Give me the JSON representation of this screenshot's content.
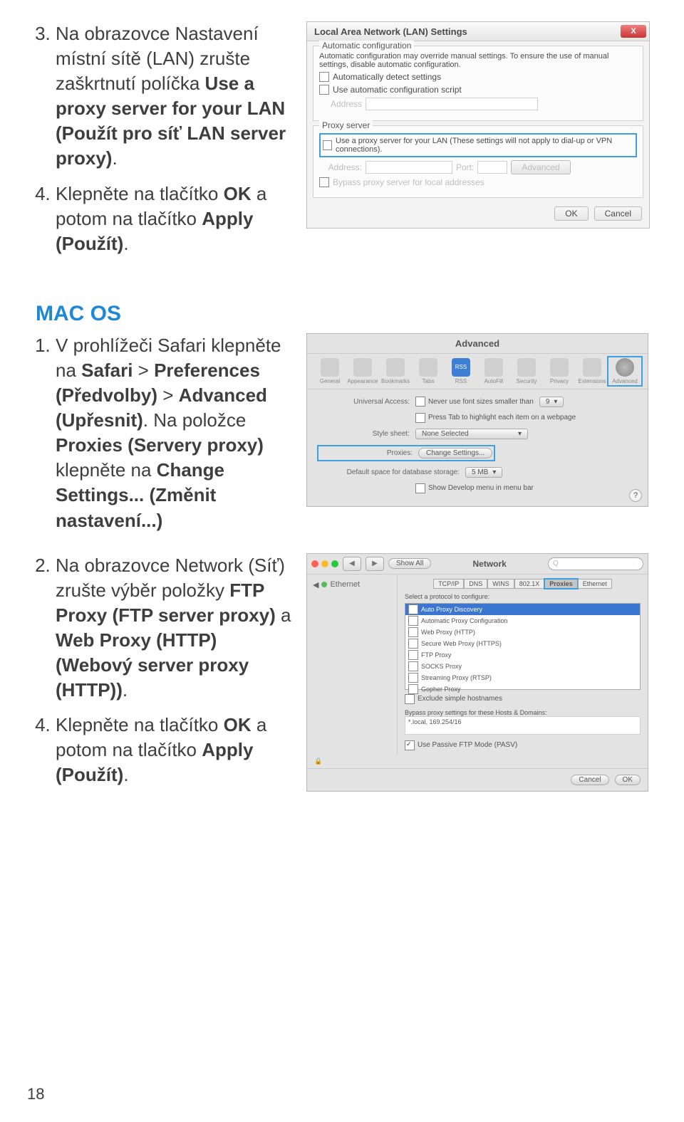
{
  "page_number": "18",
  "top_section": {
    "step3": {
      "num": "3.",
      "prefix": "Na obrazovce Nastavení místní sítě (LAN) zrušte zaškrtnutí políčka ",
      "bold1": "Use a proxy server for your LAN (Použít pro síť LAN server proxy)",
      "suffix": "."
    },
    "step4": {
      "num": "4.",
      "prefix": "Klepněte na tlačítko ",
      "bold1": "OK",
      "mid": " a potom na tlačítko ",
      "bold2": "Apply (Použít)",
      "suffix": "."
    }
  },
  "lan_dialog": {
    "title": "Local Area Network (LAN) Settings",
    "auto_caption": "Automatic configuration",
    "auto_desc": "Automatic configuration may override manual settings. To ensure the use of manual settings, disable automatic configuration.",
    "auto_detect": "Automatically detect settings",
    "auto_script": "Use automatic configuration script",
    "address_lbl": "Address",
    "proxy_caption": "Proxy server",
    "proxy_chk": "Use a proxy server for your LAN (These settings will not apply to dial-up or VPN connections).",
    "addr_lbl": "Address:",
    "port_lbl": "Port:",
    "advanced_btn": "Advanced",
    "bypass": "Bypass proxy server for local addresses",
    "ok": "OK",
    "cancel": "Cancel"
  },
  "macos_heading": "MAC OS",
  "macos_steps": {
    "step1": {
      "s1": "V prohlížeči Safari klepněte na ",
      "b1": "Safari",
      "s2": " > ",
      "b2": "Preferences (Předvolby)",
      "s3": " > ",
      "b3": "Advanced (Upřesnit)",
      "s4": ". Na položce ",
      "b4": "Proxies (Servery proxy)",
      "s5": " klepněte na ",
      "b5": "Change Settings... (Změnit nastavení...)"
    },
    "step2": {
      "s1": "Na obrazovce Network (Síť) zrušte výběr položky ",
      "b1": "FTP Proxy (FTP server proxy)",
      "s2": " a ",
      "b2": "Web Proxy (HTTP) (Webový server proxy (HTTP))",
      "s3": "."
    },
    "step4": {
      "s1": "Klepněte na tlačítko ",
      "b1": "OK",
      "s2": " a potom na tlačítko ",
      "b2": "Apply (Použít)",
      "s3": "."
    }
  },
  "mac_adv": {
    "title": "Advanced",
    "tabs": [
      "General",
      "Appearance",
      "Bookmarks",
      "Tabs",
      "RSS",
      "AutoFill",
      "Security",
      "Privacy",
      "Extensions",
      "Advanced"
    ],
    "ua_lbl": "Universal Access:",
    "ua_chk": "Never use font sizes smaller than",
    "ua_sel": "9",
    "tab_chk": "Press Tab to highlight each item on a webpage",
    "style_lbl": "Style sheet:",
    "style_sel": "None Selected",
    "proxies_lbl": "Proxies:",
    "proxies_btn": "Change Settings...",
    "db_lbl": "Default space for database storage:",
    "db_sel": "5 MB",
    "dev_chk": "Show Develop menu in menu bar"
  },
  "mac_net": {
    "title": "Network",
    "show_all": "Show All",
    "search_ph": "Q",
    "side_label": "Ethernet",
    "tabs": [
      "TCP/IP",
      "DNS",
      "WINS",
      "802.1X",
      "Proxies",
      "Ethernet"
    ],
    "configure_lbl": "Select a protocol to configure:",
    "protocols": [
      "Auto Proxy Discovery",
      "Automatic Proxy Configuration",
      "Web Proxy (HTTP)",
      "Secure Web Proxy (HTTPS)",
      "FTP Proxy",
      "SOCKS Proxy",
      "Streaming Proxy (RTSP)",
      "Gopher Proxy"
    ],
    "exclude": "Exclude simple hostnames",
    "bypass_lbl": "Bypass proxy settings for these Hosts & Domains:",
    "bypass_val": "*.local, 169.254/16",
    "passive": "Use Passive FTP Mode (PASV)",
    "cancel": "Cancel",
    "ok": "OK"
  }
}
